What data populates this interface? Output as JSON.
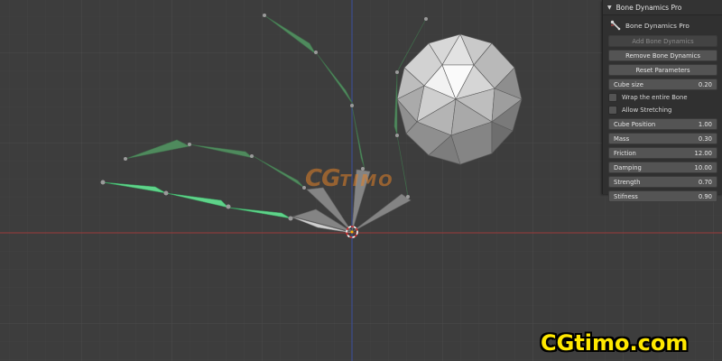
{
  "panel": {
    "header_title": "Bone Dynamics Pro",
    "subtitle": "Bone Dynamics Pro",
    "add_button": "Add Bone Dynamics",
    "remove_button": "Remove Bone Dynamics",
    "reset_button": "Reset Parameters",
    "cube_size": {
      "label": "Cube size",
      "value": "0.20"
    },
    "wrap_checkbox": {
      "label": "Wrap the entire Bone",
      "checked": false
    },
    "stretch_checkbox": {
      "label": "Allow Stretching",
      "checked": false
    },
    "params": [
      {
        "label": "Cube Position",
        "value": "1.00"
      },
      {
        "label": "Mass",
        "value": "0.30"
      },
      {
        "label": "Friction",
        "value": "12.00"
      },
      {
        "label": "Damping",
        "value": "10.00"
      },
      {
        "label": "Strength",
        "value": "0.70"
      },
      {
        "label": "Stifness",
        "value": "0.90"
      }
    ]
  },
  "watermarks": {
    "center_c": "CG",
    "center_rest": "TIMO",
    "corner": "CGtimo.com"
  },
  "colors": {
    "viewport_bg": "#3d3d3d",
    "bone_selected": "#5fd38a",
    "bone_dim": "#4f8a5d",
    "axis_x": "#9b3a3a",
    "axis_y": "#3c4fa0"
  }
}
